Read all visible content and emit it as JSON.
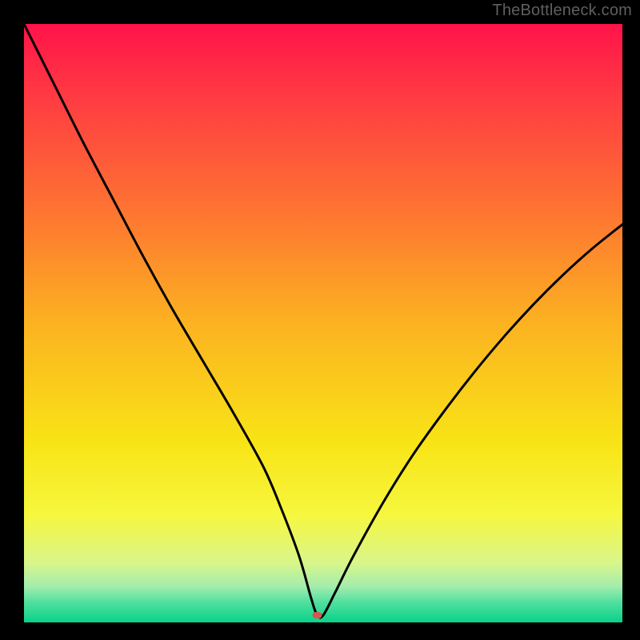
{
  "watermark": "TheBottleneck.com",
  "chart_data": {
    "type": "line",
    "title": "",
    "xlabel": "",
    "ylabel": "",
    "xlim": [
      0,
      100
    ],
    "ylim": [
      0,
      100
    ],
    "optimum_x": 49,
    "marker": {
      "x": 49,
      "y": 1.2,
      "color": "#d9544f"
    },
    "series": [
      {
        "name": "bottleneck-curve",
        "x": [
          0,
          5,
          10,
          15,
          20,
          25,
          30,
          35,
          40,
          43,
          46,
          48,
          49,
          50,
          52,
          55,
          60,
          65,
          70,
          75,
          80,
          85,
          90,
          95,
          100
        ],
        "values": [
          100,
          90,
          80,
          70.5,
          61,
          52,
          43.5,
          35,
          26,
          19,
          11,
          4,
          1.2,
          1.2,
          5,
          11,
          20,
          28,
          35,
          41.5,
          47.5,
          53,
          58,
          62.5,
          66.5
        ]
      }
    ],
    "gradient": {
      "stops": [
        {
          "offset": 0.0,
          "color": "#ff134a"
        },
        {
          "offset": 0.12,
          "color": "#ff3a42"
        },
        {
          "offset": 0.3,
          "color": "#fe7033"
        },
        {
          "offset": 0.5,
          "color": "#fcb221"
        },
        {
          "offset": 0.7,
          "color": "#f8e416"
        },
        {
          "offset": 0.82,
          "color": "#f6f73e"
        },
        {
          "offset": 0.9,
          "color": "#d9f68a"
        },
        {
          "offset": 0.94,
          "color": "#a3edad"
        },
        {
          "offset": 0.965,
          "color": "#55e0a0"
        },
        {
          "offset": 1.0,
          "color": "#06d38a"
        }
      ]
    }
  }
}
